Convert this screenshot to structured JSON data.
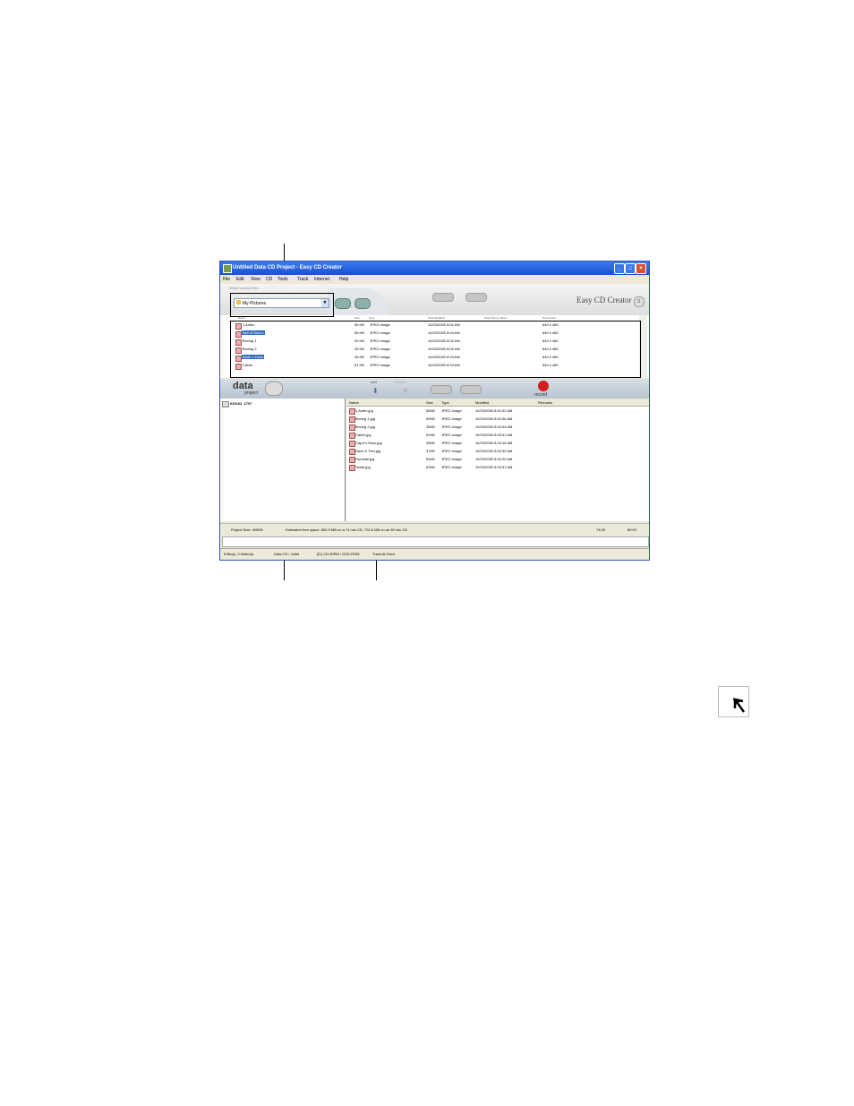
{
  "window": {
    "title": "Untitled Data CD Project - Easy CD Creator",
    "minimize": "_",
    "maximize": "□",
    "close": "×"
  },
  "menu": [
    "File",
    "Edit",
    "View",
    "CD",
    "Tools",
    "Track",
    "Internet",
    "Help"
  ],
  "source": {
    "look_in_label": "Select source files:",
    "dropdown_value": "My Pictures",
    "logo_text": "Easy CD Creator",
    "logo_version": "5",
    "columns": [
      "Name",
      "Size",
      "Type",
      "Date Modified",
      "Date Picture Taken",
      "Dimensions"
    ],
    "files": [
      {
        "name": "1 Antec",
        "size": "56 KB",
        "type": "JPEG Image",
        "modified": "10/23/2000 8:01 AM",
        "dims": "640 x 480",
        "selected": false
      },
      {
        "name": "Ball of Bacon",
        "size": "58 KB",
        "type": "JPEG Image",
        "modified": "10/23/2000 8:04 AM",
        "dims": "640 x 480",
        "selected": true
      },
      {
        "name": "Boxing 1",
        "size": "59 KB",
        "type": "JPEG Image",
        "modified": "10/23/2000 8:02 AM",
        "dims": "640 x 480",
        "selected": false
      },
      {
        "name": "Boxing 2",
        "size": "36 KB",
        "type": "JPEG Image",
        "modified": "10/23/2000 8:02 AM",
        "dims": "640 x 480",
        "selected": false
      },
      {
        "name": "Bride n Dairy",
        "size": "38 KB",
        "type": "JPEG Image",
        "modified": "10/23/2000 8:03 AM",
        "dims": "640 x 480",
        "selected": true
      },
      {
        "name": "Calvin",
        "size": "61 KB",
        "type": "JPEG Image",
        "modified": "10/23/2000 8:03 AM",
        "dims": "640 x 480",
        "selected": false
      }
    ]
  },
  "project": {
    "logo_main": "data",
    "logo_sub": "project",
    "add_label": "add",
    "remove_label": "remove",
    "record_label": "record",
    "tree_root": "020102_1707",
    "columns": [
      "Name",
      "Size",
      "Type",
      "Modified",
      "Remarks"
    ],
    "files": [
      {
        "name": "1 Antec.jpg",
        "size": "56KB",
        "type": "JPEG Image",
        "modified": "10/23/2000 8:01:52 AM"
      },
      {
        "name": "Boxing 1.jpg",
        "size": "59KB",
        "type": "JPEG Image",
        "modified": "10/23/2000 8:01:56 AM"
      },
      {
        "name": "Boxing 2.jpg",
        "size": "36KB",
        "type": "JPEG Image",
        "modified": "10/23/2000 8:02:04 AM"
      },
      {
        "name": "Calvin.jpg",
        "size": "61KB",
        "type": "JPEG Image",
        "modified": "10/23/2000 8:03:41 AM"
      },
      {
        "name": "Cap'n'n Mom.jpg",
        "size": "39KB",
        "type": "JPEG Image",
        "modified": "10/23/2000 8:03:16 AM"
      },
      {
        "name": "Dave & Trev.jpg",
        "size": "37KB",
        "type": "JPEG Image",
        "modified": "10/23/2000 8:04:30 AM"
      },
      {
        "name": "Hornball.jpg",
        "size": "54KB",
        "type": "JPEG Image",
        "modified": "10/23/2000 8:02:20 AM"
      },
      {
        "name": "Towel.jpg",
        "size": "63KB",
        "type": "JPEG Image",
        "modified": "10/23/2000 8:03:31 AM"
      }
    ]
  },
  "status": {
    "project_size": "Project Size: 405KB",
    "free_space": "Estimated free space: 650.9 MB on a 74 min CD, 702.6 MB on an 80 min CD",
    "time_74": "74:00",
    "time_80": "80:00",
    "bottom_left": "8 file(s), 0 folder(s)",
    "bottom_mid": "Data CD / Joliet",
    "bottom_drive": "[D:] CD-R/RW / DVD-ROM",
    "bottom_right": "Track At Once"
  }
}
